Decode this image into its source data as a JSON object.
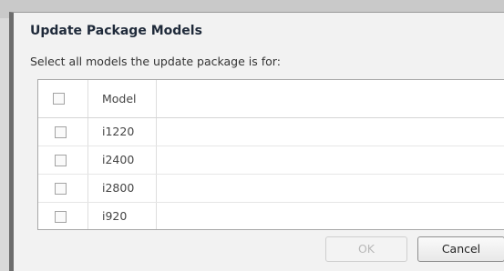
{
  "dialog": {
    "title": "Update Package Models",
    "instruction": "Select all models the update package is for:"
  },
  "grid": {
    "header": {
      "column": "Model",
      "select_all_checked": false
    },
    "rows": [
      {
        "model": "i1220",
        "checked": false
      },
      {
        "model": "i2400",
        "checked": false
      },
      {
        "model": "i2800",
        "checked": false
      },
      {
        "model": "i920",
        "checked": false
      }
    ]
  },
  "buttons": {
    "ok_label": "OK",
    "ok_enabled": false,
    "cancel_label": "Cancel"
  }
}
